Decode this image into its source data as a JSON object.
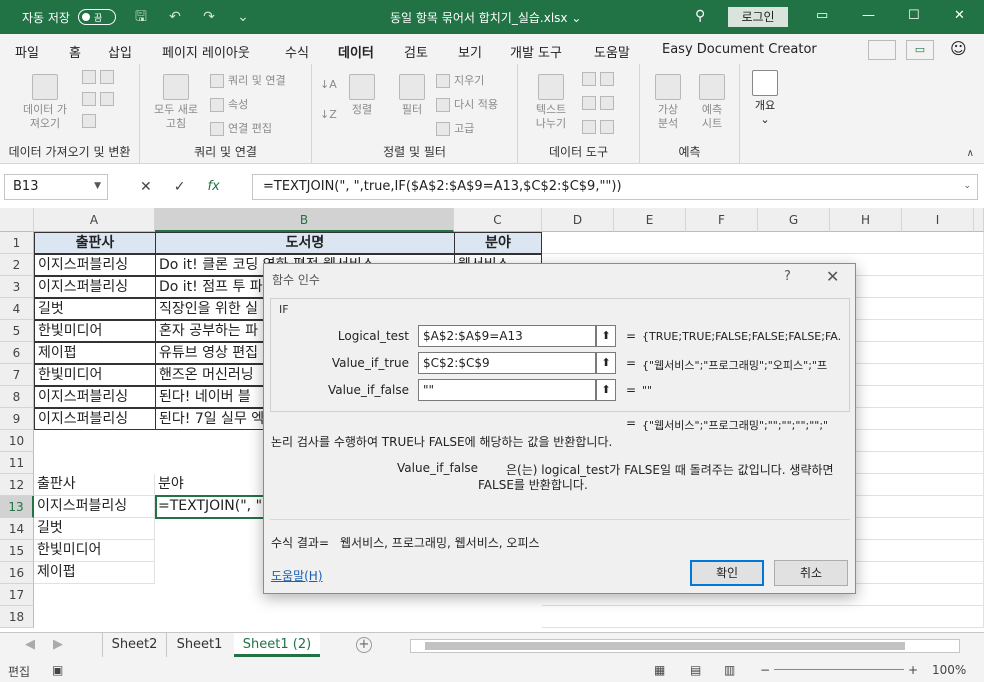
{
  "titlebar": {
    "autosave_label": "자동 저장",
    "autosave_state": "끔",
    "filename": "동일 항목 묶어서 합치기_실습.xlsx",
    "login": "로그인"
  },
  "tabs": [
    "파일",
    "홈",
    "삽입",
    "페이지 레이아웃",
    "수식",
    "데이터",
    "검토",
    "보기",
    "개발 도구",
    "도움말",
    "Easy Document Creator"
  ],
  "active_tab": "데이터",
  "ribbon": {
    "g1": {
      "btn": "데이터 가\n져오기",
      "label": "데이터 가져오기 및 변환"
    },
    "g2": {
      "btn": "모두 새로\n고침",
      "s1": "쿼리 및 연결",
      "s2": "속성",
      "s3": "연결 편집",
      "label": "쿼리 및 연결"
    },
    "g3": {
      "sort": "정렬",
      "filter": "필터",
      "s1": "지우기",
      "s2": "다시 적용",
      "s3": "고급",
      "label": "정렬 및 필터"
    },
    "g4": {
      "btn": "텍스트\n나누기",
      "label": "데이터 도구"
    },
    "g5": {
      "b1": "가상\n분석",
      "b2": "예측\n시트",
      "label": "예측"
    },
    "g6": {
      "btn": "개요"
    }
  },
  "formula_bar": {
    "namebox": "B13",
    "formula": "=TEXTJOIN(\", \",true,IF($A$2:$A$9=A13,$C$2:$C$9,\"\"))"
  },
  "columns": [
    "A",
    "B",
    "C",
    "D",
    "E",
    "F",
    "G",
    "H",
    "I"
  ],
  "rows": [
    "1",
    "2",
    "3",
    "4",
    "5",
    "6",
    "7",
    "8",
    "9",
    "10",
    "11",
    "12",
    "13",
    "14",
    "15",
    "16",
    "17",
    "18"
  ],
  "table": {
    "headers": [
      "출판사",
      "도서명",
      "분야"
    ],
    "a": [
      "이지스퍼블리싱",
      "이지스퍼블리싱",
      "길벗",
      "한빛미디어",
      "제이펍",
      "한빛미디어",
      "이지스퍼블리싱",
      "이지스퍼블리싱"
    ],
    "b": [
      "Do it! 클론 코딩 영화 평점 웹서비스",
      "Do it! 점프 투 파",
      "직장인을 위한 실",
      "혼자 공부하는 파",
      "유튜브 영상 편집",
      "핸즈온 머신러닝",
      "된다! 네이버 블",
      "된다! 7일 실무 엑"
    ],
    "c2": "웹서비스"
  },
  "lower": {
    "a12": "출판사",
    "b12": "분야",
    "a13": "이지스퍼블리싱",
    "b13": "=TEXTJOIN(\", \",",
    "a14": "길벗",
    "a15": "한빛미디어",
    "a16": "제이펍"
  },
  "sheets": [
    "Sheet2",
    "Sheet1",
    "Sheet1 (2)"
  ],
  "status": {
    "mode": "편집",
    "zoom": "100%"
  },
  "dialog": {
    "title": "함수 인수",
    "help": "?",
    "function": "IF",
    "args": [
      {
        "label": "Logical_test",
        "value": "$A$2:$A$9=A13",
        "result": "{TRUE;TRUE;FALSE;FALSE;FALSE;FA..."
      },
      {
        "label": "Value_if_true",
        "value": "$C$2:$C$9",
        "result": "{\"웹서비스\";\"프로그래밍\";\"오피스\";\"프"
      },
      {
        "label": "Value_if_false",
        "value": "\"\"",
        "result": "\"\""
      }
    ],
    "result_line": "{\"웹서비스\";\"프로그래밍\";\"\";\"\";\"\";\"\";\"",
    "description": "논리 검사를 수행하여 TRUE나 FALSE에 해당하는 값을 반환합니다.",
    "arg_name": "Value_if_false",
    "arg_desc_1": "은(는) logical_test가 FALSE일 때 돌려주는 값입니다. 생략하면",
    "arg_desc_2": "FALSE를 반환합니다.",
    "formula_result_label": "수식 결과=",
    "formula_result": "웹서비스, 프로그래밍, 웹서비스, 오피스",
    "help_link": "도움말(H)",
    "ok": "확인",
    "cancel": "취소"
  }
}
